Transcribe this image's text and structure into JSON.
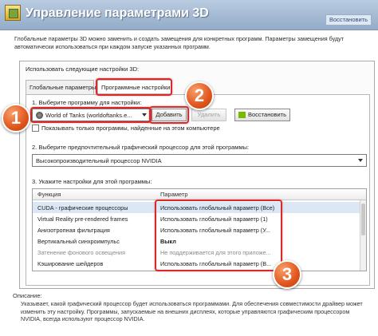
{
  "header": {
    "title": "Управление параметрами 3D",
    "restore_label": "Восстановить",
    "icon": "nvidia-panel-icon"
  },
  "intro": "Глобальные параметры 3D можно заменить и создать замещения для конкретных программ. Параметры замещения будут автоматически использоваться при каждом запуске указанных программ.",
  "use_settings_label": "Использовать следующие настройки 3D:",
  "tabs": [
    {
      "label": "Глобальные параметры",
      "active": false
    },
    {
      "label": "Программные настройки",
      "active": true
    }
  ],
  "step1": {
    "label": "1. Выберите программу для настройки:",
    "program_value": "World of Tanks (worldoftanks.e...",
    "add_label": "Добавить",
    "remove_label": "Удалить",
    "restore_label": "Восстановить",
    "checkbox_label": "Показывать только программы, найденные на этом компьютере",
    "checkbox_checked": false
  },
  "step2": {
    "label": "2. Выберите предпочтительный графический процессор для этой программы:",
    "value": "Высокопроизводительный процессор NVIDIA"
  },
  "step3": {
    "label": "3. Укажите настройки для этой программы:",
    "columns": {
      "function": "Функция",
      "parameter": "Параметр"
    },
    "rows": [
      {
        "function": "CUDA - графические процессоры",
        "parameter": "Использовать глобальный параметр (Все)"
      },
      {
        "function": "Virtual Reality pre-rendered frames",
        "parameter": "Использовать глобальный параметр (1)"
      },
      {
        "function": "Анизотропная фильтрация",
        "parameter": "Использовать глобальный параметр (У..."
      },
      {
        "function": "Вертикальный синхроимпульс",
        "parameter": "Выкл"
      },
      {
        "function": "Затенение фонового освещения",
        "parameter": "Не поддерживается для этого приложе..."
      },
      {
        "function": "Кэширование шейдеров",
        "parameter": "Использовать глобальный параметр (В..."
      }
    ]
  },
  "description": {
    "title": "Описание:",
    "text": "Указывает, какой графический процессор будет использоваться программами. Для обеспечения совместимости драйвер может изменить эту настройку. Программы, запускаемые на внешних дисплеях, которые управляются графическим процессором NVIDIA, всегда используют процессор NVIDIA."
  },
  "callouts": [
    "1",
    "2",
    "3"
  ],
  "colors": {
    "highlight": "#d92a2a",
    "badge": "#e0561c",
    "header": "#a6bbd4"
  }
}
